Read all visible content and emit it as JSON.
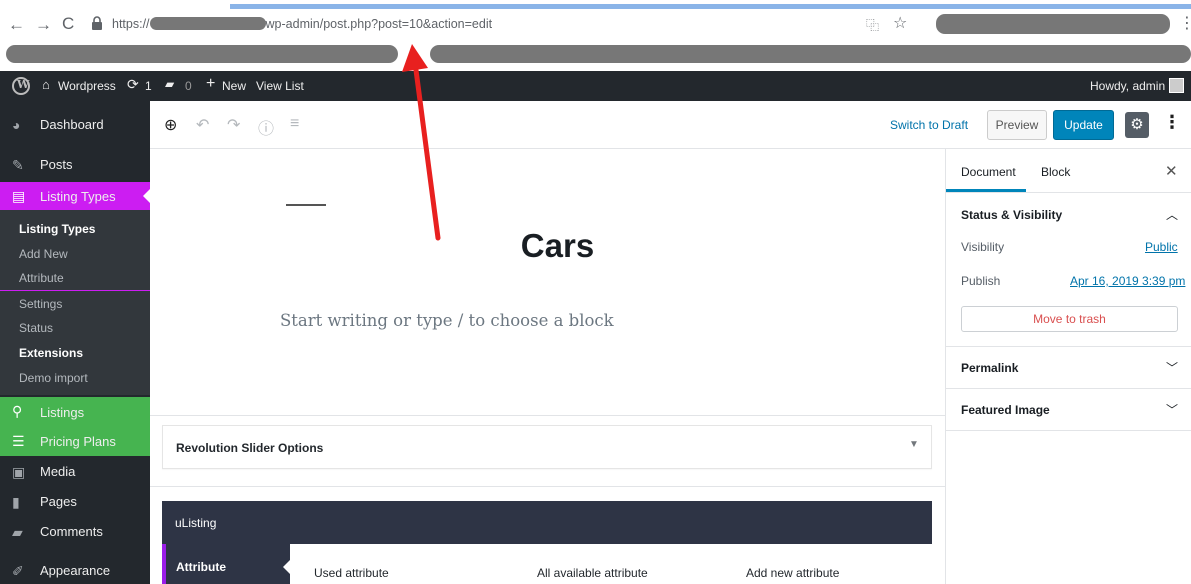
{
  "browser": {
    "address_scheme": "https://",
    "address_path": "wp-admin/post.php?post=10&action=edit",
    "icons": [
      "back-icon",
      "forward-icon",
      "reload-icon",
      "lock-icon",
      "translate-icon",
      "star-icon",
      "menu-icon"
    ]
  },
  "adminbar": {
    "site_name": "Wordpress",
    "updates_count": "1",
    "comments_count": "0",
    "new_label": "New",
    "view_list_label": "View List",
    "greeting": "Howdy, admin"
  },
  "sidebar": {
    "items": [
      {
        "label": "Dashboard",
        "icon": "dashboard-icon"
      },
      {
        "label": "Posts",
        "icon": "pin-icon"
      },
      {
        "label": "Listing Types",
        "icon": "listing-types-icon"
      },
      {
        "label": "Listings",
        "icon": "location-icon"
      },
      {
        "label": "Pricing Plans",
        "icon": "pricing-icon"
      },
      {
        "label": "Media",
        "icon": "media-icon"
      },
      {
        "label": "Pages",
        "icon": "pages-icon"
      },
      {
        "label": "Comments",
        "icon": "comment-icon"
      },
      {
        "label": "Appearance",
        "icon": "brush-icon"
      }
    ],
    "submenu": [
      "Listing Types",
      "Add New",
      "Attribute",
      "Settings",
      "Status",
      "Extensions",
      "Demo import"
    ],
    "colors": {
      "listing_types": "#cc1df2",
      "listings": "#46b450",
      "pricing": "#46b450",
      "background": "#23282d"
    }
  },
  "editor": {
    "switch_to_draft": "Switch to Draft",
    "preview": "Preview",
    "update": "Update",
    "title": "Cars",
    "placeholder": "Start writing or type / to choose a block"
  },
  "metaboxes": {
    "revolution_slider": "Revolution Slider Options",
    "ulisting": {
      "title": "uListing",
      "tab": "Attribute",
      "columns": [
        "Used attribute",
        "All available attribute",
        "Add new attribute"
      ]
    }
  },
  "settings_panel": {
    "tabs": [
      "Document",
      "Block"
    ],
    "status_visibility": "Status & Visibility",
    "visibility_label": "Visibility",
    "visibility_value": "Public",
    "publish_label": "Publish",
    "publish_value": "Apr 16, 2019 3:39 pm",
    "trash": "Move to trash",
    "permalink": "Permalink",
    "featured_image": "Featured Image"
  }
}
